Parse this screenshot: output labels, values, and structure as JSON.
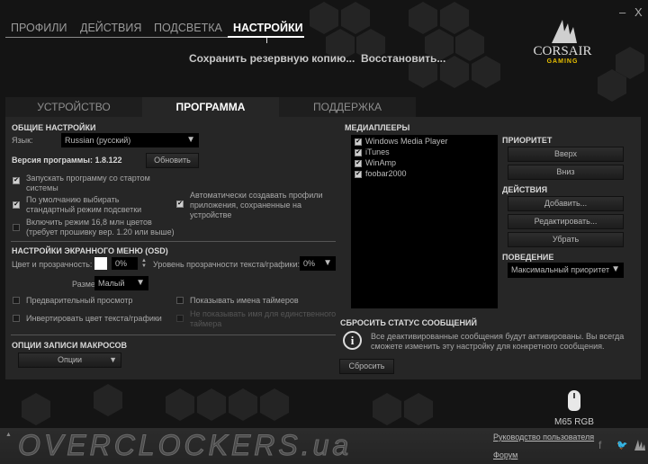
{
  "window": {
    "minimize": "–",
    "close": "X"
  },
  "nav": [
    "ПРОФИЛИ",
    "ДЕЙСТВИЯ",
    "ПОДСВЕТКА",
    "НАСТРОЙКИ"
  ],
  "top_actions": {
    "backup": "Сохранить резервную копию...",
    "restore": "Восстановить..."
  },
  "logo": {
    "brand": "CORSAIR",
    "sub": "GAMING"
  },
  "subtabs": [
    "УСТРОЙСТВО",
    "ПРОГРАММА",
    "ПОДДЕРЖКА"
  ],
  "general": {
    "title": "ОБЩИЕ НАСТРОЙКИ",
    "language_label": "Язык:",
    "language_value": "Russian (русский)",
    "version": "Версия программы: 1.8.122",
    "update": "Обновить",
    "checks": [
      {
        "label": "Запускать программу со стартом системы",
        "checked": true
      },
      {
        "label": "По умолчанию выбирать стандартный режим подсветки",
        "checked": true
      },
      {
        "label": "Включить режим 16,8 млн цветов (требует прошивку вер. 1.20 или выше)",
        "checked": false
      },
      {
        "label": "Автоматически создавать профили приложения, сохраненные на устройстве",
        "checked": true
      }
    ]
  },
  "osd": {
    "title": "НАСТРОЙКИ ЭКРАННОГО МЕНЮ (OSD)",
    "color_label": "Цвет и прозрачность:",
    "color_value": "0%",
    "text_alpha_label": "Уровень прозрачности текста/графики:",
    "text_alpha_value": "0%",
    "size_label": "Размер:",
    "size_value": "Малый",
    "checks": [
      {
        "label": "Предварительный просмотр",
        "checked": false
      },
      {
        "label": "Показывать имена таймеров",
        "checked": false
      },
      {
        "label": "Инвертировать цвет текста/графики",
        "checked": false
      },
      {
        "label": "Не показывать имя для единственного таймера",
        "checked": false,
        "disabled": true
      }
    ]
  },
  "macro": {
    "title": "ОПЦИИ ЗАПИСИ МАКРОСОВ",
    "options": "Опции"
  },
  "media": {
    "title": "МЕДИАПЛЕЕРЫ",
    "players": [
      "Windows Media Player",
      "iTunes",
      "WinAmp",
      "foobar2000"
    ],
    "priority": "ПРИОРИТЕТ",
    "up": "Вверх",
    "down": "Вниз",
    "actions": "ДЕЙСТВИЯ",
    "add": "Добавить...",
    "edit": "Редактировать...",
    "remove": "Убрать",
    "behavior": "ПОВЕДЕНИЕ",
    "behavior_value": "Максимальный приоритет"
  },
  "reset": {
    "title": "СБРОСИТЬ СТАТУС СООБЩЕНИЙ",
    "text": "Все деактивированные сообщения будут активированы. Вы всегда сможете изменить эту настройку для конкретного сообщения.",
    "button": "Сбросить"
  },
  "device": {
    "name": "M65 RGB"
  },
  "footer": {
    "watermark": "OVERCLOCKERS.ua",
    "manual": "Руководство пользователя",
    "forum": "Форум"
  }
}
